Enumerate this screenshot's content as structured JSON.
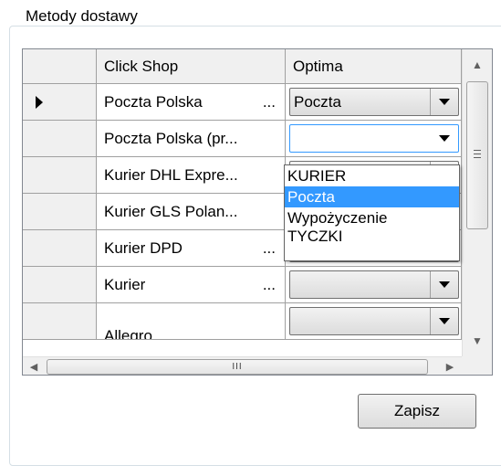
{
  "group": {
    "title": "Metody dostawy"
  },
  "grid": {
    "columns": [
      "Click Shop",
      "Optima"
    ],
    "rows": [
      {
        "click_shop": "Poczta Polska",
        "ellipsis": "...",
        "optima": "Poczta"
      },
      {
        "click_shop": "Poczta Polska (pr...",
        "ellipsis": "",
        "optima": ""
      },
      {
        "click_shop": "Kurier DHL Expre...",
        "ellipsis": "",
        "optima": ""
      },
      {
        "click_shop": "Kurier GLS Polan...",
        "ellipsis": "",
        "optima": ""
      },
      {
        "click_shop": "Kurier DPD",
        "ellipsis": "...",
        "optima": ""
      },
      {
        "click_shop": "Kurier",
        "ellipsis": "...",
        "optima": ""
      },
      {
        "click_shop": "Allegro",
        "ellipsis": "",
        "optima": ""
      }
    ],
    "hscroll_grip": "III"
  },
  "dropdown": {
    "options": [
      "KURIER",
      "Poczta",
      "Wypożyczenie",
      "TYCZKI"
    ],
    "selected": "Poczta"
  },
  "buttons": {
    "save_label": "Zapisz"
  },
  "colors": {
    "selection": "#3399ff",
    "header_bg": "#f0f0f0",
    "grid_border": "#828790"
  }
}
